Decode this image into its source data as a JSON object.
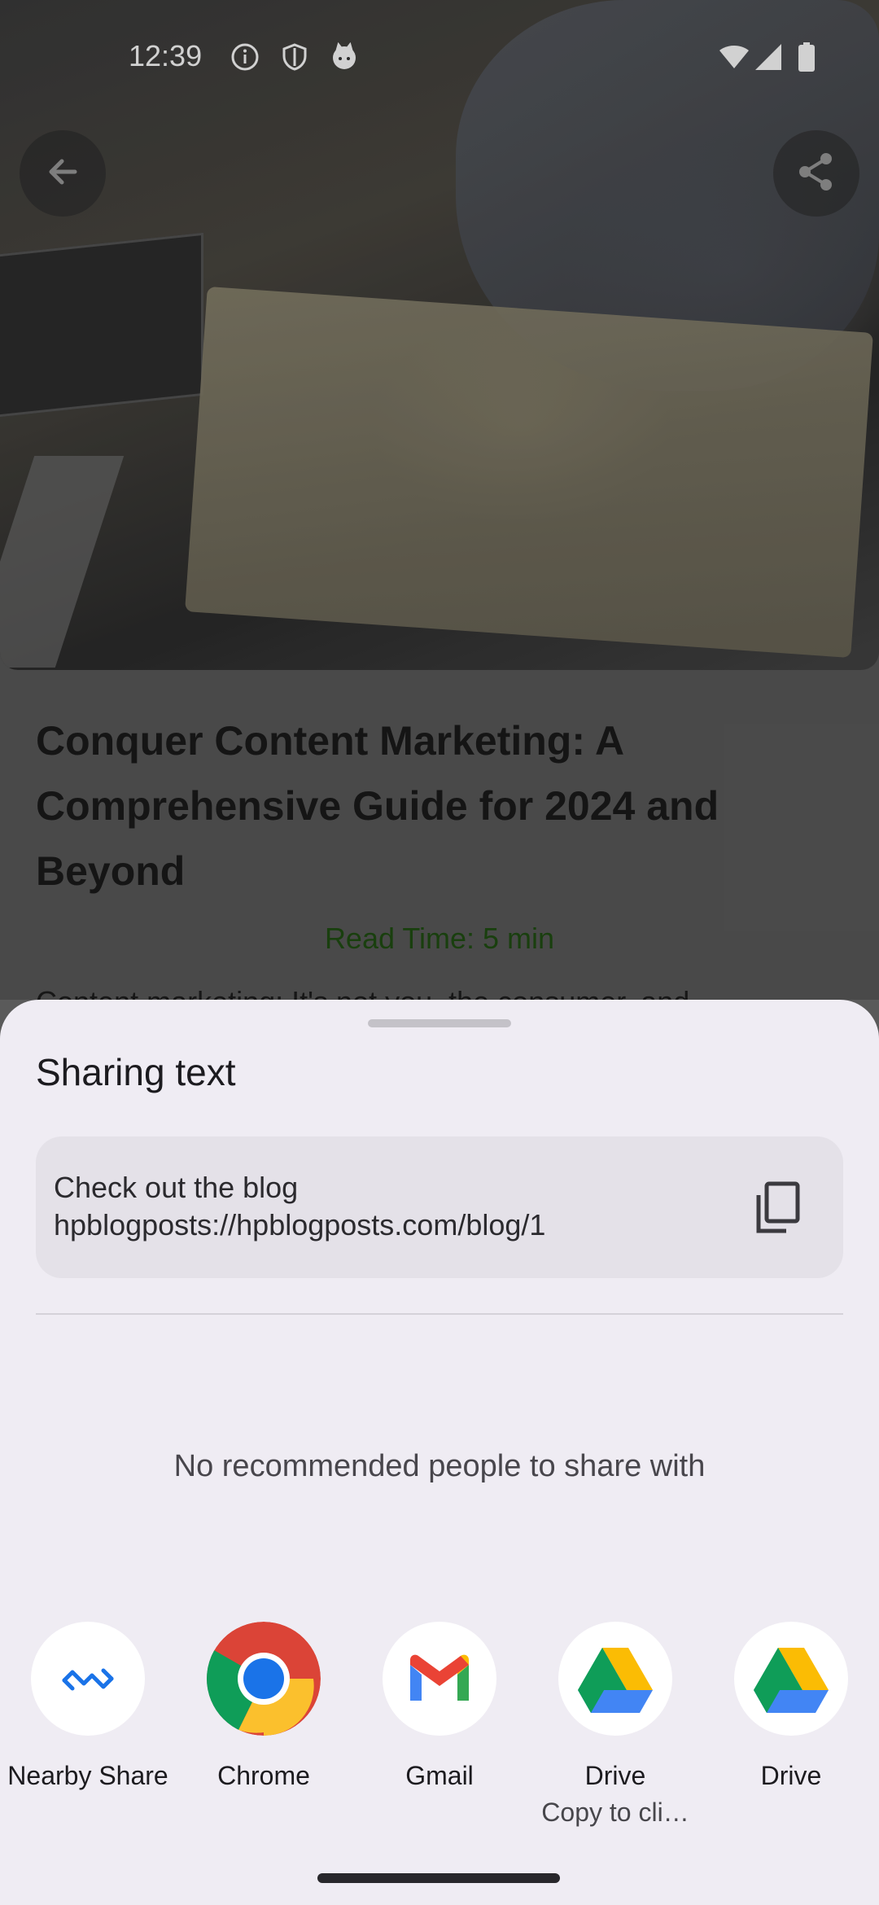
{
  "status_bar": {
    "time": "12:39",
    "left_icons": [
      "info-icon",
      "shield-icon",
      "cat-face-icon"
    ],
    "right_icons": [
      "wifi-icon",
      "cellular-signal-icon",
      "battery-icon"
    ]
  },
  "article": {
    "back_icon": "arrow-left-icon",
    "share_icon": "share-icon",
    "title": "Conquer Content Marketing: A Comprehensive Guide for 2024 and Beyond",
    "read_time": "Read Time: 5 min",
    "snippet": "Content marketing: It's not you, the consumer, and"
  },
  "share_sheet": {
    "title": "Sharing text",
    "share_text": "Check out the blog hpblogposts://hpblogposts.com/blog/1",
    "copy_icon": "copy-icon",
    "no_people_text": "No recommended people to share with",
    "apps": [
      {
        "label": "Nearby Share",
        "sublabel": "",
        "icon": "nearby-share-icon"
      },
      {
        "label": "Chrome",
        "sublabel": "",
        "icon": "chrome-icon"
      },
      {
        "label": "Gmail",
        "sublabel": "",
        "icon": "gmail-icon"
      },
      {
        "label": "Drive",
        "sublabel": "Copy to cli…",
        "icon": "google-drive-icon"
      },
      {
        "label": "Drive",
        "sublabel": "",
        "icon": "google-drive-icon"
      }
    ]
  },
  "colors": {
    "sheet_background": "#efecf3",
    "share_box_background": "#e4e1e8",
    "read_time_text": "#1f4e12"
  }
}
